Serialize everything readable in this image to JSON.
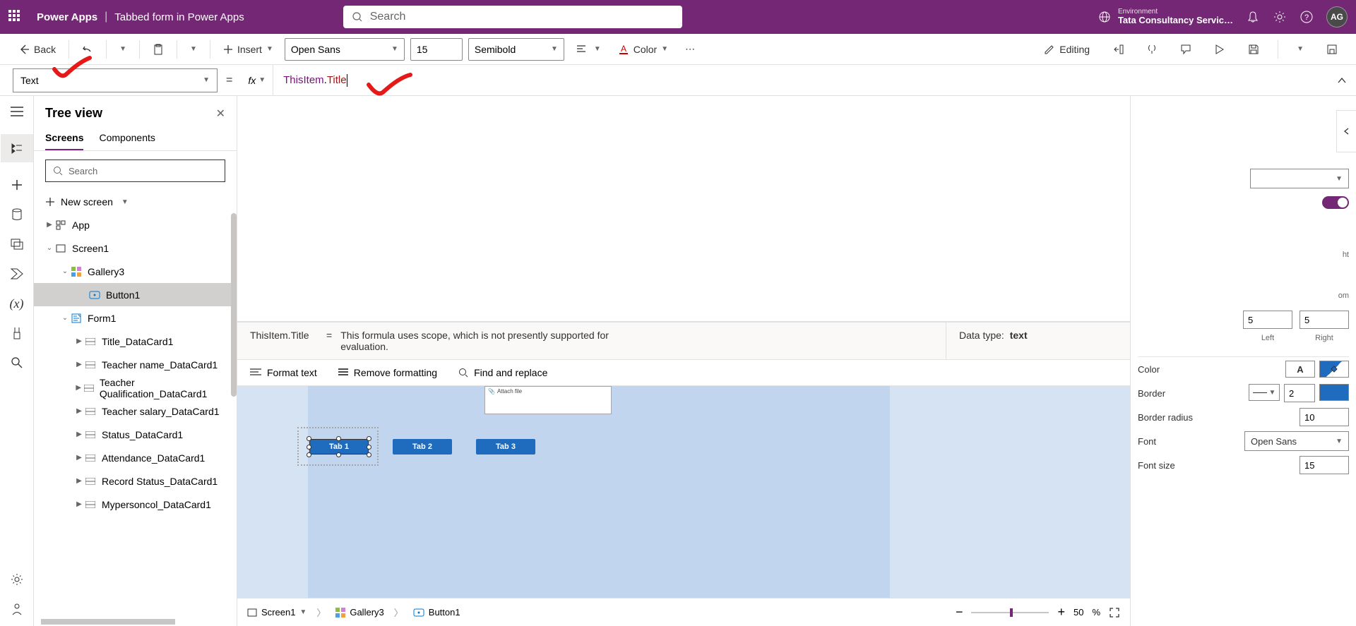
{
  "header": {
    "appName": "Power Apps",
    "separator": "|",
    "fileName": "Tabbed form in Power Apps",
    "searchPlaceholder": "Search",
    "envLabel": "Environment",
    "envName": "Tata Consultancy Servic…",
    "avatar": "AG"
  },
  "toolbar": {
    "back": "Back",
    "insert": "Insert",
    "fontFamily": "Open Sans",
    "fontSize": "15",
    "fontWeight": "Semibold",
    "color": "Color",
    "editing": "Editing"
  },
  "propertyBar": {
    "property": "Text",
    "fx": "fx",
    "formulaObject": "ThisItem",
    "formulaDot": ".",
    "formulaProp": "Title"
  },
  "formulaHelp": {
    "expr": "ThisItem.Title",
    "eq": "=",
    "msg": "This formula uses scope, which is not presently supported for evaluation.",
    "dataTypeLabel": "Data type:",
    "dataType": "text"
  },
  "formulaActions": {
    "format": "Format text",
    "remove": "Remove formatting",
    "find": "Find and replace"
  },
  "treeView": {
    "title": "Tree view",
    "tabScreens": "Screens",
    "tabComponents": "Components",
    "searchPlaceholder": "Search",
    "newScreen": "New screen",
    "items": {
      "app": "App",
      "screen1": "Screen1",
      "gallery3": "Gallery3",
      "button1": "Button1",
      "form1": "Form1",
      "card1": "Title_DataCard1",
      "card2": "Teacher name_DataCard1",
      "card3": "Teacher Qualification_DataCard1",
      "card4": "Teacher salary_DataCard1",
      "card5": "Status_DataCard1",
      "card6": "Attendance_DataCard1",
      "card7": "Record Status_DataCard1",
      "card8": "Mypersoncol_DataCard1"
    }
  },
  "canvas": {
    "attachHint": "Attach file",
    "tab1": "Tab 1",
    "tab2": "Tab 2",
    "tab3": "Tab 3"
  },
  "rightPanel": {
    "left": "5",
    "right": "5",
    "leftLabel": "Left",
    "rightLabel": "Right",
    "ht": "ht",
    "om": "om",
    "colorLabel": "Color",
    "borderLabel": "Border",
    "borderVal": "2",
    "radiusLabel": "Border radius",
    "radiusVal": "10",
    "fontLabel": "Font",
    "fontVal": "Open Sans",
    "fontSizeLabel": "Font size",
    "fontSizeVal": "15"
  },
  "breadcrumb": {
    "screen": "Screen1",
    "gallery": "Gallery3",
    "button": "Button1",
    "zoom": "50",
    "pct": "%"
  }
}
